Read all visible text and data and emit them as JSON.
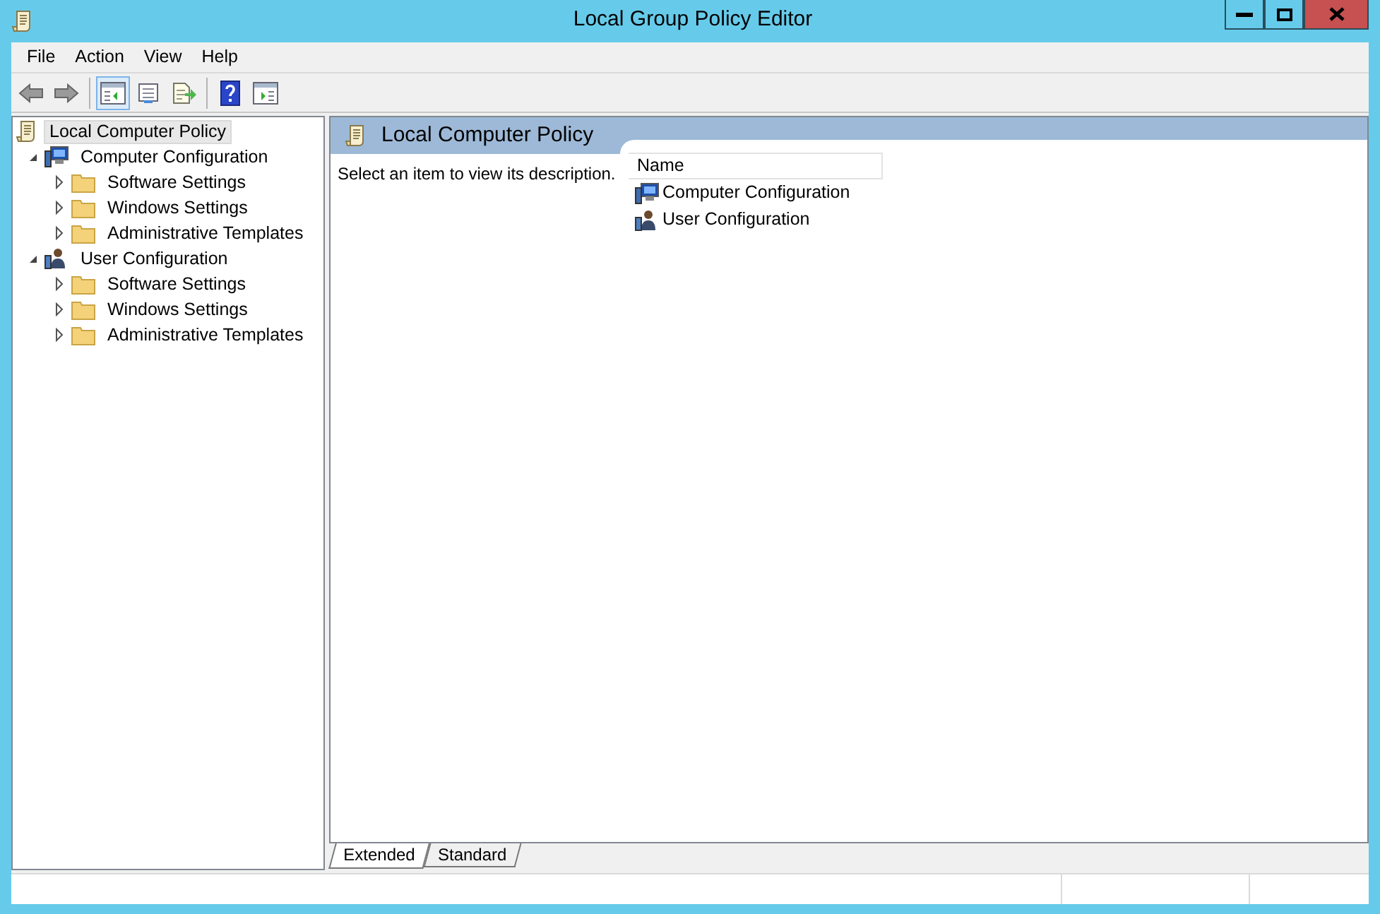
{
  "window": {
    "title": "Local Group Policy Editor"
  },
  "menu": [
    "File",
    "Action",
    "View",
    "Help"
  ],
  "toolbar": [
    {
      "kind": "back",
      "disabled": true
    },
    {
      "kind": "forward",
      "disabled": true
    },
    {
      "kind": "separator"
    },
    {
      "kind": "show-tree",
      "pressed": true
    },
    {
      "kind": "properties",
      "pressed": false
    },
    {
      "kind": "export",
      "pressed": false
    },
    {
      "kind": "separator"
    },
    {
      "kind": "help",
      "pressed": false
    },
    {
      "kind": "show-action",
      "pressed": false
    }
  ],
  "tree": [
    {
      "label": "Local Computer Policy",
      "kind": "scroll",
      "selected": true,
      "children": [
        {
          "label": "Computer Configuration",
          "kind": "computer",
          "selected": false,
          "expanded": true,
          "children": [
            {
              "label": "Software Settings",
              "kind": "folder",
              "selected": false,
              "expanded": false
            },
            {
              "label": "Windows Settings",
              "kind": "folder",
              "selected": false,
              "expanded": false
            },
            {
              "label": "Administrative Templates",
              "kind": "folder",
              "selected": false,
              "expanded": false
            }
          ]
        },
        {
          "label": "User Configuration",
          "kind": "user",
          "selected": false,
          "expanded": true,
          "children": [
            {
              "label": "Software Settings",
              "kind": "folder",
              "selected": false,
              "expanded": false
            },
            {
              "label": "Windows Settings",
              "kind": "folder",
              "selected": false,
              "expanded": false
            },
            {
              "label": "Administrative Templates",
              "kind": "folder",
              "selected": false,
              "expanded": false
            }
          ]
        }
      ]
    }
  ],
  "details": {
    "title": "Local Computer Policy",
    "description": "Select an item to view its description.",
    "columns": [
      "Name"
    ],
    "rows": [
      {
        "label": "Computer Configuration",
        "kind": "computer"
      },
      {
        "label": "User Configuration",
        "kind": "user"
      }
    ]
  },
  "tabs": [
    {
      "label": "Extended",
      "selected": true
    },
    {
      "label": "Standard",
      "selected": false
    }
  ]
}
